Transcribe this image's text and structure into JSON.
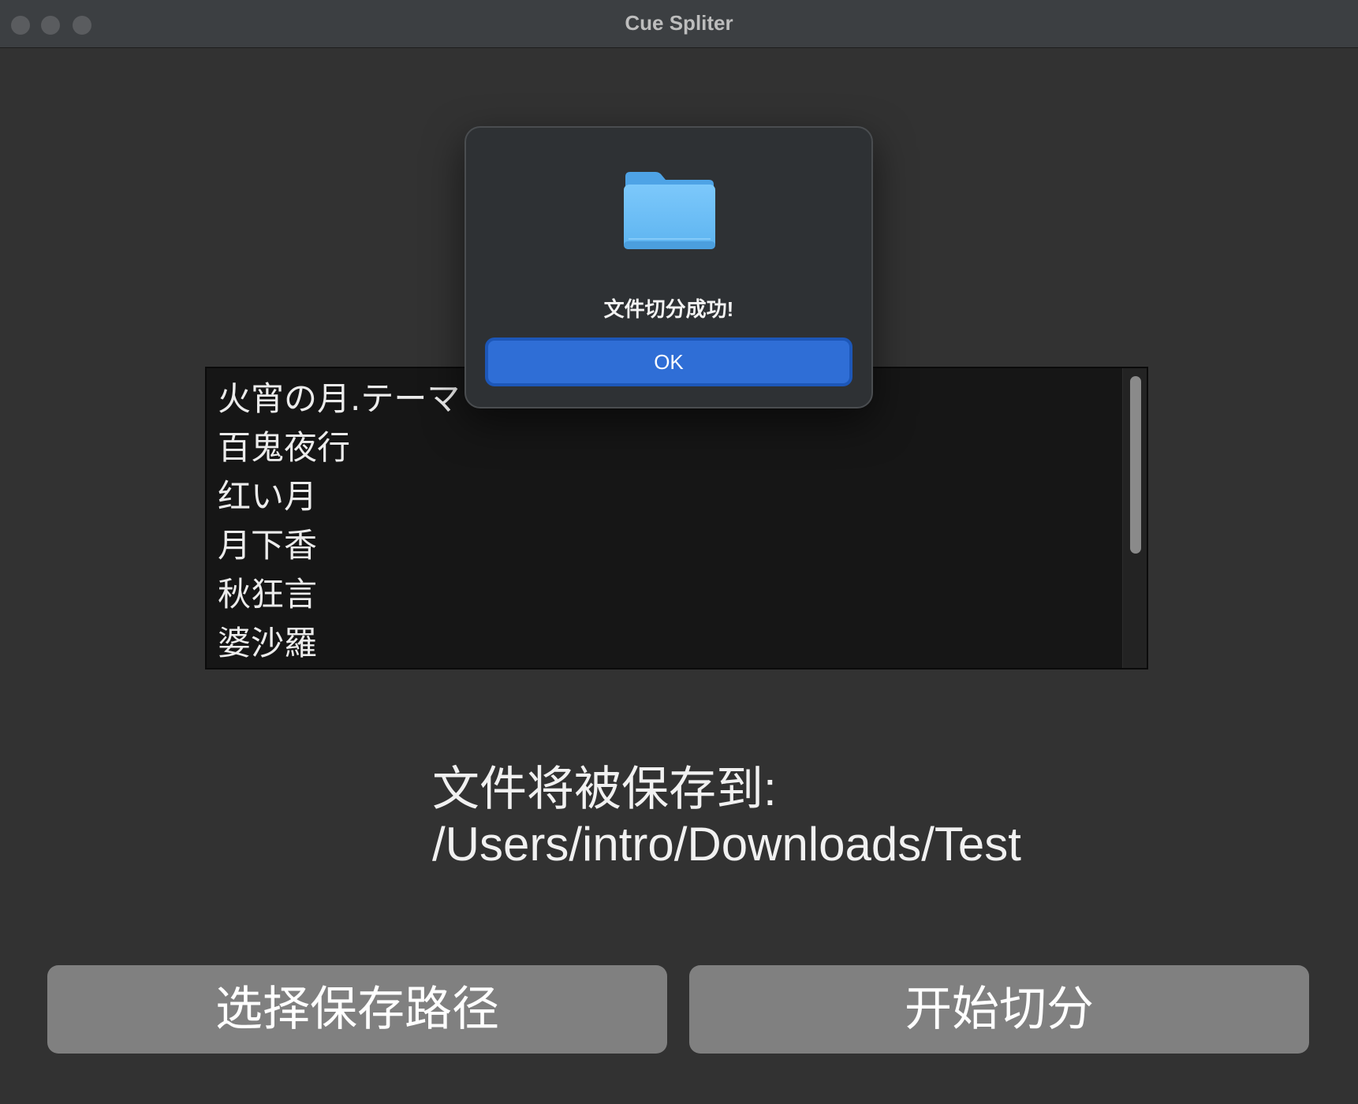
{
  "window": {
    "title": "Cue Spliter"
  },
  "tracks": [
    "火宵の月.テーマ",
    "百鬼夜行",
    "红い月",
    "月下香",
    "秋狂言",
    "婆沙羅"
  ],
  "save_path_text": "文件将被保存到: /Users/intro/Downloads/Test",
  "buttons": {
    "choose_path": "选择保存路径",
    "start_split": "开始切分"
  },
  "dialog": {
    "icon": "folder-icon",
    "message": "文件切分成功!",
    "ok_label": "OK"
  },
  "colors": {
    "accent": "#2f6ed6",
    "button_gray": "#808080",
    "window_bg": "#323232"
  }
}
